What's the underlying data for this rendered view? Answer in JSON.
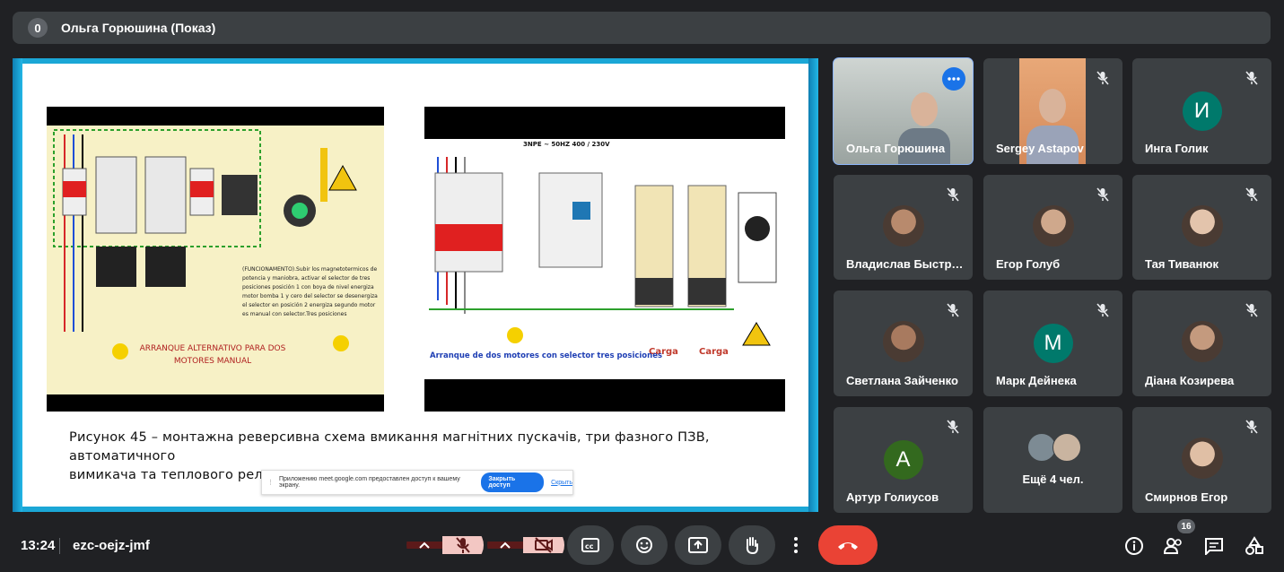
{
  "header": {
    "count": "0",
    "title": "Ольга Горюшина (Показ)"
  },
  "presentation": {
    "left_image_label": "ARRANQUE ALTERNATIVO PARA DOS MOTORES MANUAL",
    "right_image_label": "Arranque de dos motores con selector tres posiciones",
    "right_image_header": "3NPE ~ 50HZ  400 / 230V",
    "caption_line1": "Рисунок 45 – монтажна реверсивна  схема вмикання магнітних пускачів, три фазного ПЗВ, автоматичного",
    "caption_line2": "вимикача та теплового реле",
    "notice_text": "Приложению meet.google.com предоставлен доступ к вашему экрану.",
    "notice_button": "Закрыть доступ",
    "notice_hide": "Скрыть"
  },
  "participants": [
    {
      "name": "Ольга Горюшина",
      "kind": "photo"
    },
    {
      "name": "Sergey Astapov",
      "kind": "photo"
    },
    {
      "name": "Инга Голик",
      "kind": "letter",
      "letter": "И",
      "color": "#00796b"
    },
    {
      "name": "Владислав Быстр…",
      "kind": "photo"
    },
    {
      "name": "Егор Голуб",
      "kind": "photo"
    },
    {
      "name": "Тая Тиванюк",
      "kind": "photo"
    },
    {
      "name": "Светлана Зайченко",
      "kind": "photo"
    },
    {
      "name": "Марк Дейнека",
      "kind": "letter",
      "letter": "М",
      "color": "#00796b"
    },
    {
      "name": "Діана Козирева",
      "kind": "photo"
    },
    {
      "name": "Артур Голиусов",
      "kind": "letter",
      "letter": "А",
      "color": "#33691e"
    },
    {
      "name": "Ещё 4 чел.",
      "kind": "group"
    },
    {
      "name": "Смирнов Егор",
      "kind": "photo"
    }
  ],
  "bottom": {
    "time": "13:24",
    "meeting_code": "ezc-oejz-jmf",
    "people_count": "16"
  },
  "colors": {
    "accent": "#1a73e8",
    "leave": "#ea4335",
    "muted_bg": "#f3c7c3"
  }
}
